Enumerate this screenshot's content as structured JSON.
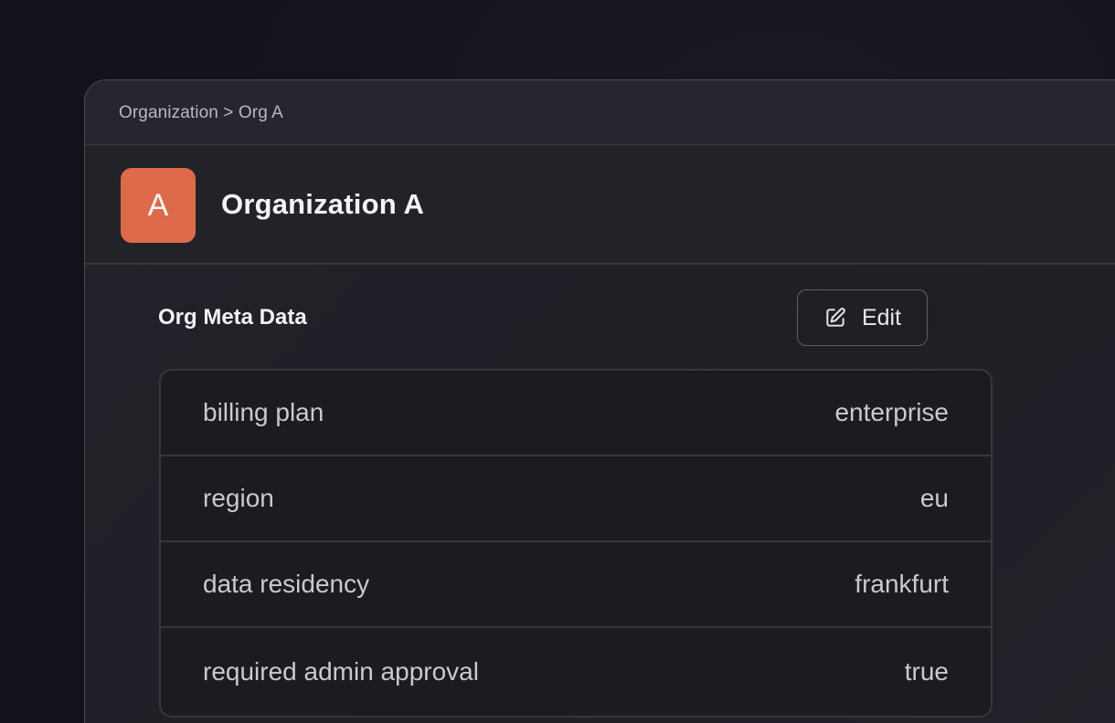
{
  "breadcrumb": {
    "text": "Organization > Org A"
  },
  "org": {
    "avatar_letter": "A",
    "avatar_color": "#de6a4a",
    "name": "Organization A"
  },
  "meta_section": {
    "title": "Org Meta Data",
    "edit_label": "Edit",
    "edit_icon": "edit-icon",
    "rows": [
      {
        "key": "billing plan",
        "value": "enterprise"
      },
      {
        "key": "region",
        "value": "eu"
      },
      {
        "key": "data residency",
        "value": "frankfurt"
      },
      {
        "key": "required admin approval",
        "value": "true"
      }
    ]
  }
}
